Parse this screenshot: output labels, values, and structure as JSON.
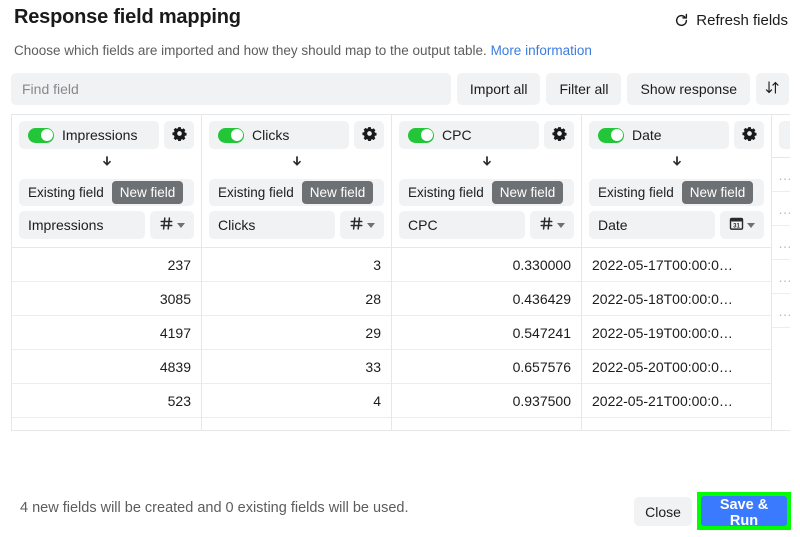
{
  "header": {
    "title": "Response field mapping",
    "refresh_label": "Refresh fields",
    "refresh_icon": "refresh-ccw-icon"
  },
  "subtitle": {
    "text": "Choose which fields are imported and how they should map to the output table.",
    "link_text": "More information"
  },
  "toolbar": {
    "search_placeholder": "Find field",
    "search_value": "",
    "import_all_label": "Import all",
    "filter_all_label": "Filter all",
    "show_response_label": "Show response",
    "sort_icon": "sort-updown-icon"
  },
  "mapping": {
    "segment_options": [
      "Existing field",
      "New field"
    ],
    "gear_icon": "gear-icon",
    "arrow_icon": "arrow-down-icon",
    "columns": [
      {
        "field_name": "Impressions",
        "enabled": true,
        "mapping_mode": "New field",
        "output_name": "Impressions",
        "type_icon": "number-hash-icon",
        "align": "num"
      },
      {
        "field_name": "Clicks",
        "enabled": true,
        "mapping_mode": "New field",
        "output_name": "Clicks",
        "type_icon": "number-hash-icon",
        "align": "num"
      },
      {
        "field_name": "CPC",
        "enabled": true,
        "mapping_mode": "New field",
        "output_name": "CPC",
        "type_icon": "number-hash-icon",
        "align": "num"
      },
      {
        "field_name": "Date",
        "enabled": true,
        "mapping_mode": "New field",
        "output_name": "Date",
        "type_icon": "calendar-31-icon",
        "align": "txt"
      }
    ],
    "rows": [
      [
        "237",
        "3",
        "0.330000",
        "2022-05-17T00:00:0…",
        "…"
      ],
      [
        "3085",
        "28",
        "0.436429",
        "2022-05-18T00:00:0…",
        "…"
      ],
      [
        "4197",
        "29",
        "0.547241",
        "2022-05-19T00:00:0…",
        "…"
      ],
      [
        "4839",
        "33",
        "0.657576",
        "2022-05-20T00:00:0…",
        "…"
      ],
      [
        "523",
        "4",
        "0.937500",
        "2022-05-21T00:00:0…",
        "…"
      ]
    ]
  },
  "footer": {
    "note": "4 new fields will be created and 0 existing fields will be used.",
    "close_label": "Close",
    "save_label": "Save & Run"
  },
  "colors": {
    "toggle_on": "#22c638",
    "primary_button": "#3a7afe",
    "highlight": "#00ff00",
    "link": "#3b7ddd",
    "chip_background": "#f1f2f3",
    "segment_active": "#6e7174"
  }
}
